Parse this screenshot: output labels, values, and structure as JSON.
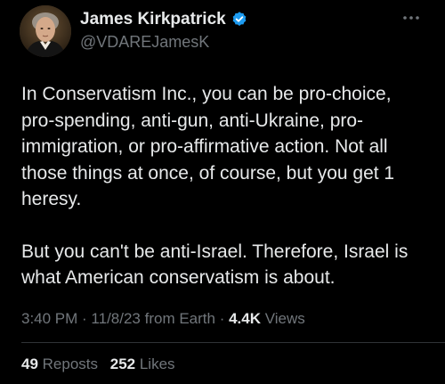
{
  "author": {
    "display_name": "James Kirkpatrick",
    "handle": "@VDAREJamesK",
    "avatar_icon": "portrait-avatar",
    "verified_icon": "verified-badge-icon",
    "verified_color": "#1d9bf0"
  },
  "tweet": {
    "paragraphs": [
      "In Conservatism Inc., you can be pro-choice, pro-spending, anti-gun, anti-Ukraine, pro-immigration, or pro-affirmative action. Not all those things at once, of course, but you get 1 heresy.",
      "But you can't be anti-Israel. Therefore, Israel is what American conservatism is about."
    ]
  },
  "meta": {
    "time": "3:40 PM",
    "sep1": " · ",
    "date": "11/8/23",
    "source": " from Earth",
    "sep2": " · ",
    "views_count": "4.4K",
    "views_label": " Views"
  },
  "stats": {
    "reposts_count": "49",
    "reposts_label": " Reposts",
    "likes_count": "252",
    "likes_label": " Likes"
  },
  "colors": {
    "background": "#000000",
    "primary_text": "#e7e9ea",
    "secondary_text": "#71767b",
    "divider": "#2f3336"
  }
}
